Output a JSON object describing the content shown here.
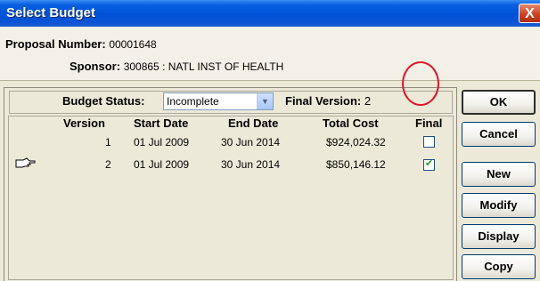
{
  "window": {
    "title": "Select Budget",
    "close_glyph": "X"
  },
  "header": {
    "proposal_label": "Proposal Number:",
    "proposal_value": "00001648",
    "sponsor_label": "Sponsor:",
    "sponsor_value": "300865 : NATL INST OF HEALTH"
  },
  "status": {
    "budget_status_label": "Budget Status:",
    "budget_status_value": "Incomplete",
    "final_version_label": "Final Version:",
    "final_version_value": "2"
  },
  "table": {
    "columns": [
      "Version",
      "Start Date",
      "End Date",
      "Total Cost",
      "Final"
    ],
    "rows": [
      {
        "version": "1",
        "start_date": "01 Jul 2009",
        "end_date": "30 Jun 2014",
        "total_cost": "$924,024.32",
        "final": false
      },
      {
        "version": "2",
        "start_date": "01 Jul 2009",
        "end_date": "30 Jun 2014",
        "total_cost": "$850,146.12",
        "final": true
      }
    ]
  },
  "buttons": {
    "ok": "OK",
    "cancel": "Cancel",
    "new": "New",
    "modify": "Modify",
    "display": "Display",
    "copy": "Copy"
  },
  "icons": {
    "row_pointer": "pointing-hand-icon",
    "dropdown": "chevron-down-icon",
    "close": "close-icon"
  },
  "colors": {
    "titlebar": "#0051d8",
    "highlight_circle": "#e0142c",
    "checkmark": "#21a121"
  }
}
